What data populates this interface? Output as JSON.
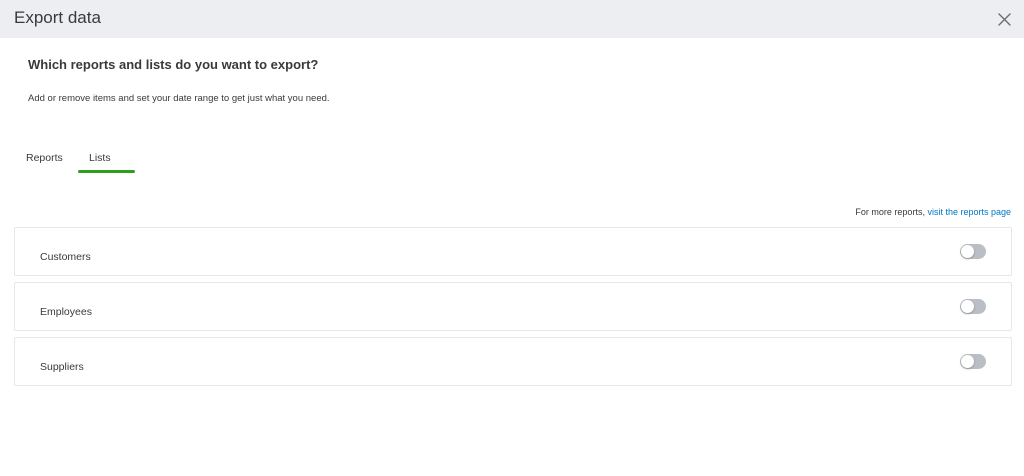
{
  "dialog": {
    "title": "Export data",
    "close_icon": "close-icon"
  },
  "main": {
    "question": "Which reports and lists do you want to export?",
    "subtext": "Add or remove items and set your date range to get just what you need."
  },
  "tabs": [
    {
      "label": "Reports",
      "active": false
    },
    {
      "label": "Lists",
      "active": true
    }
  ],
  "more_reports": {
    "prefix": "For more reports, ",
    "link": "visit the reports page"
  },
  "lists": [
    {
      "label": "Customers",
      "enabled": false
    },
    {
      "label": "Employees",
      "enabled": false
    },
    {
      "label": "Suppliers",
      "enabled": false
    }
  ],
  "colors": {
    "accent": "#2ca01c",
    "link": "#0077c5",
    "toggle_off": "#babec5",
    "header_bg": "#eceef1"
  }
}
